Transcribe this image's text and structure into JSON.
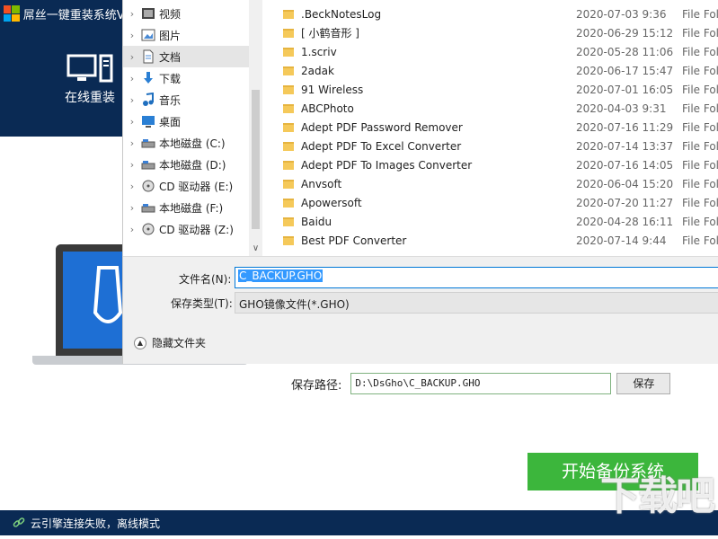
{
  "app": {
    "title": "屌丝一键重装系统V",
    "nav_online_reinstall": "在线重装",
    "save_path_label": "保存路径:",
    "save_path_value": "D:\\DsGho\\C_BACKUP.GHO",
    "save_button": "保存",
    "start_backup_button": "开始备份系统",
    "status_text": "云引擎连接失败，离线模式",
    "watermark": "下载吧",
    "colors": {
      "sidebar": "#0a2a54",
      "start_button": "#3cb63c",
      "status_bar": "#0a2a54"
    }
  },
  "dialog": {
    "nav_items": [
      {
        "label": "视频",
        "icon": "video-icon",
        "selected": false
      },
      {
        "label": "图片",
        "icon": "picture-icon",
        "selected": false
      },
      {
        "label": "文档",
        "icon": "document-icon",
        "selected": true
      },
      {
        "label": "下载",
        "icon": "download-icon",
        "selected": false
      },
      {
        "label": "音乐",
        "icon": "music-icon",
        "selected": false
      },
      {
        "label": "桌面",
        "icon": "desktop-icon",
        "selected": false
      },
      {
        "label": "本地磁盘 (C:)",
        "icon": "drive-icon",
        "selected": false
      },
      {
        "label": "本地磁盘 (D:)",
        "icon": "drive-icon",
        "selected": false
      },
      {
        "label": "CD 驱动器 (E:)",
        "icon": "cd-drive-icon",
        "selected": false
      },
      {
        "label": "本地磁盘 (F:)",
        "icon": "drive-icon",
        "selected": false
      },
      {
        "label": "CD 驱动器 (Z:)",
        "icon": "cd-drive-icon",
        "selected": false
      }
    ],
    "files": [
      {
        "name": ".BeckNotesLog",
        "date": "2020-07-03 9:36",
        "type": "File Fol"
      },
      {
        "name": "[ 小鹤音形 ]",
        "date": "2020-06-29 15:12",
        "type": "File Fol"
      },
      {
        "name": "1.scriv",
        "date": "2020-05-28 11:06",
        "type": "File Fol"
      },
      {
        "name": "2adak",
        "date": "2020-06-17 15:47",
        "type": "File Fol"
      },
      {
        "name": "91 Wireless",
        "date": "2020-07-01 16:05",
        "type": "File Fol"
      },
      {
        "name": "ABCPhoto",
        "date": "2020-04-03 9:31",
        "type": "File Fol"
      },
      {
        "name": "Adept PDF Password Remover",
        "date": "2020-07-16 11:29",
        "type": "File Fol"
      },
      {
        "name": "Adept PDF To Excel Converter",
        "date": "2020-07-14 13:37",
        "type": "File Fol"
      },
      {
        "name": "Adept PDF To Images Converter",
        "date": "2020-07-16 14:05",
        "type": "File Fol"
      },
      {
        "name": "Anvsoft",
        "date": "2020-06-04 15:20",
        "type": "File Fol"
      },
      {
        "name": "Apowersoft",
        "date": "2020-07-20 11:27",
        "type": "File Fol"
      },
      {
        "name": "Baidu",
        "date": "2020-04-28 16:11",
        "type": "File Fol"
      },
      {
        "name": "Best PDF Converter",
        "date": "2020-07-14 9:44",
        "type": "File Fol"
      }
    ],
    "filename_label": "文件名(N):",
    "filename_value": "C_BACKUP.GHO",
    "filetype_label": "保存类型(T):",
    "filetype_value": "GHO镜像文件(*.GHO)",
    "hide_folders_label": "隐藏文件夹"
  }
}
